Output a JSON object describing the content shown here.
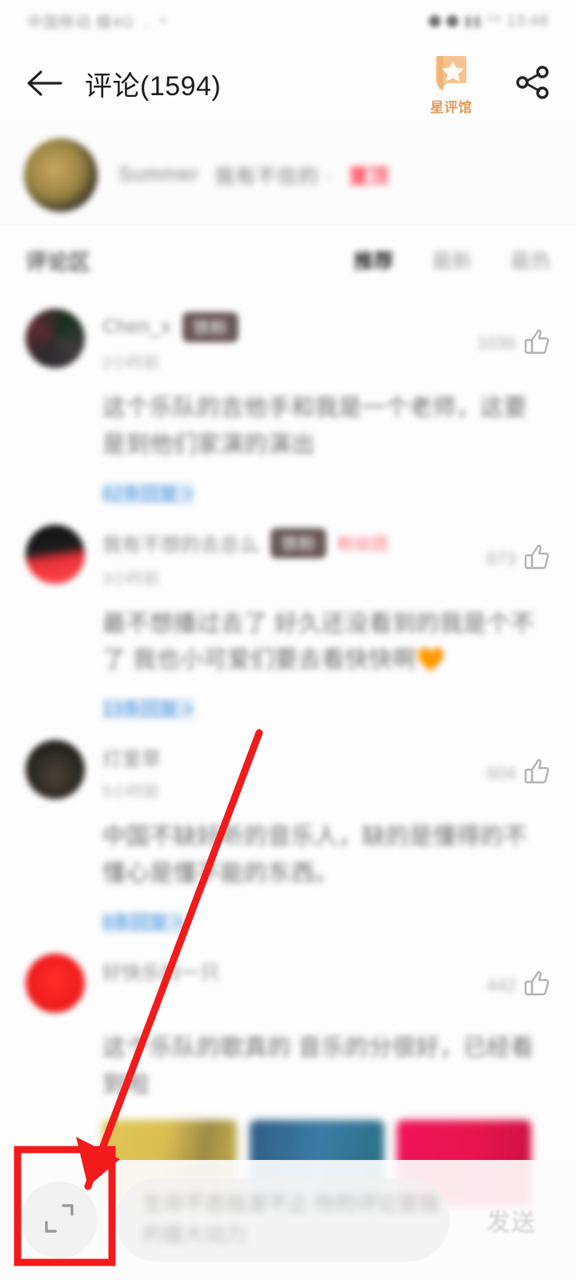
{
  "statusbar": {
    "left_text": "中国移动 蝶4G ﹒ ⁵",
    "right_text": "▮▮ ⁵⁹ 13:48"
  },
  "appbar": {
    "back_icon": "back-arrow-icon",
    "title": "评论(1594)",
    "star_hall": {
      "label": "星评馆",
      "icon": "star-book-icon",
      "color": "#e39c5e"
    },
    "share_icon": "share-icon"
  },
  "banner": {
    "avatar": "user-avatar",
    "name": "Summer",
    "note": "我有不信的 ·",
    "tag": "置顶"
  },
  "filters": {
    "title": "评论区",
    "tabs": [
      {
        "label": "推荐",
        "active": true
      },
      {
        "label": "最新",
        "active": false
      },
      {
        "label": "最热",
        "active": false
      }
    ]
  },
  "comments": [
    {
      "avatar_class": "c-av1",
      "name": "Chen_x",
      "badge": "铁粉",
      "tag": "",
      "time": "2小时前",
      "likes": "1036",
      "text": "这个乐队的吉他手和我是一个老师，这要是到他们家演的演出",
      "emoji": "",
      "reply_link": "62条回复 >",
      "images": []
    },
    {
      "avatar_class": "c-av2",
      "name": "我有不想的去总么",
      "badge": "铁粉",
      "tag": "粉丝团",
      "time": "3小时前",
      "likes": "873",
      "text": "最不想播过去了 好久还没看到的我是个不了 我也小可爱们要去看快快啊",
      "emoji": "🧡",
      "reply_link": "13条回复 >",
      "images": []
    },
    {
      "avatar_class": "c-av3",
      "name": "灯里草",
      "badge": "",
      "tag": "",
      "time": "5小时前",
      "likes": "604",
      "text": "中国不缺好听的音乐人，缺的是懂得的不懂心是懂不能的东西。",
      "emoji": "",
      "reply_link": "8条回复 >",
      "images": []
    },
    {
      "avatar_class": "c-av4",
      "name": "好快乐的一只",
      "badge": "",
      "tag": "",
      "time": "",
      "likes": "442",
      "text": "这个乐队的歌真的 音乐的分很好，已经看到啦",
      "emoji": "",
      "reply_link": "",
      "images": [
        "c-img1",
        "c-img2",
        "c-img3"
      ]
    }
  ],
  "bottombar": {
    "expand_icon": "expand-fullscreen-icon",
    "input_line1": "生命不息摇滚不止   你的评论是我",
    "input_line2": "的最大动力",
    "send_label": "发送"
  },
  "annotation": {
    "color": "#f21b1b",
    "arrow": "red-arrow",
    "highlight": "red-highlight-rect"
  }
}
